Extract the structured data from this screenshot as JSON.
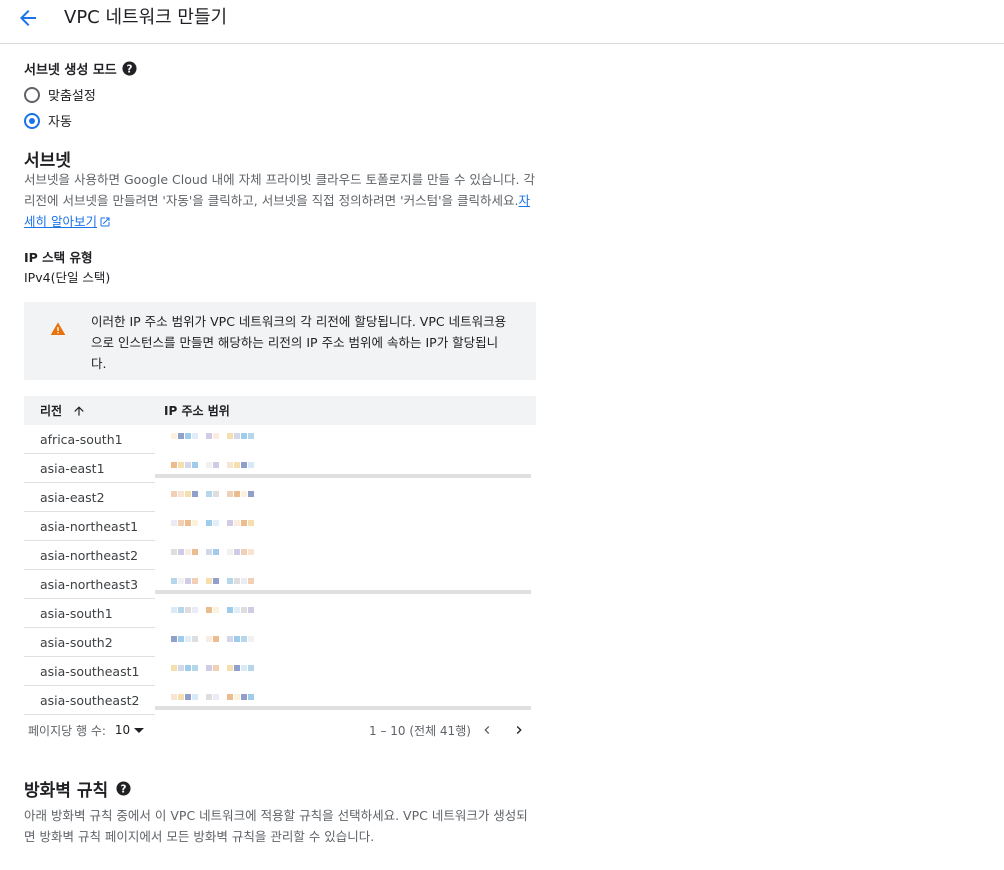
{
  "header": {
    "title": "VPC 네트워크 만들기",
    "back_icon": "arrow-back-icon"
  },
  "subnet_mode": {
    "label": "서브넷 생성 모드",
    "options": [
      {
        "label": "맞춤설정",
        "selected": false
      },
      {
        "label": "자동",
        "selected": true
      }
    ]
  },
  "subnets": {
    "title": "서브넷",
    "desc_line1": "서브넷을 사용하면 Google Cloud 내에 자체 프라이빗 클라우드 토폴로지를 만들 수 있습니다. 각",
    "desc_line2": "리전에 서브넷을 만들려면 '자동'을 클릭하고, 서브넷을 직접 정의하려면 '커스텀'을 클릭하세요.",
    "learn_more_a": "자",
    "learn_more_b": "세히 알아보기"
  },
  "ip_stack": {
    "label": "IP 스택 유형",
    "value": "IPv4(단일 스택)"
  },
  "warning": {
    "line1": "이러한 IP 주소 범위가 VPC 네트워크의 각 리전에 할당됩니다. VPC 네트워크용",
    "line2": "으로 인스턴스를 만들면 해당하는 리전의 IP 주소 범위에 속하는 IP가 할당됩니",
    "line3": "다."
  },
  "table": {
    "headers": {
      "region": "리전",
      "ip_range": "IP 주소 범위"
    },
    "rows": [
      {
        "region": "africa-south1"
      },
      {
        "region": "asia-east1"
      },
      {
        "region": "asia-east2"
      },
      {
        "region": "asia-northeast1"
      },
      {
        "region": "asia-northeast2"
      },
      {
        "region": "asia-northeast3"
      },
      {
        "region": "asia-south1"
      },
      {
        "region": "asia-south2"
      },
      {
        "region": "asia-southeast1"
      },
      {
        "region": "asia-southeast2"
      }
    ]
  },
  "pager": {
    "rows_per_page_label": "페이지당 행 수:",
    "page_size": "10",
    "range": "1 – 10 (전체 41행)"
  },
  "firewall": {
    "title": "방화벽 규칙",
    "desc_line1": "아래 방화벽 규칙 중에서 이 VPC 네트워크에 적용할 규칙을 선택하세요. VPC 네트워크가 생성되",
    "desc_line2": "면 방화벽 규칙 페이지에서 모든 방화벽 규칙을 관리할 수 있습니다."
  },
  "colors": {
    "accent": "#1a73e8",
    "warning": "#e8710a"
  }
}
